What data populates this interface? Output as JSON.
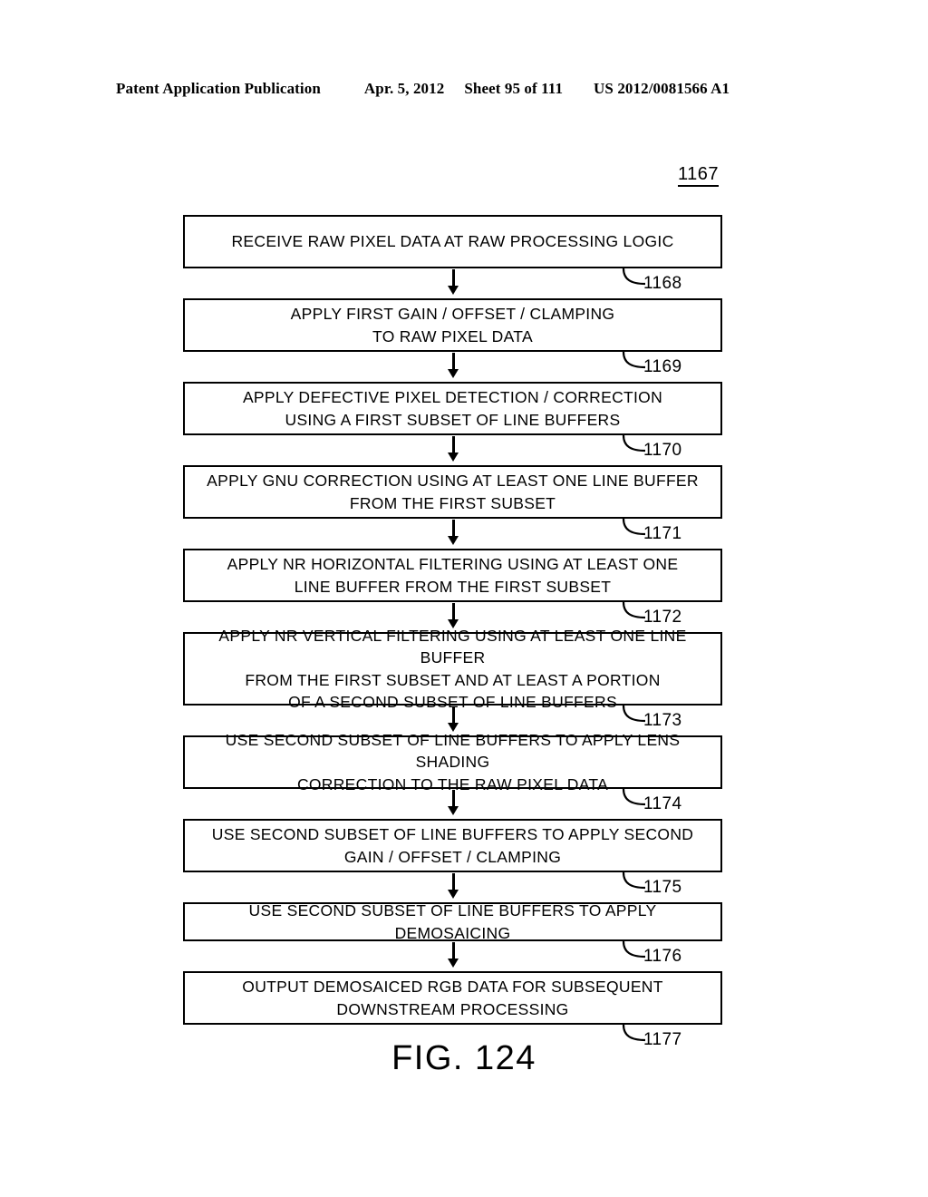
{
  "header": {
    "publication": "Patent Application Publication",
    "date": "Apr. 5, 2012",
    "sheet": "Sheet 95 of 111",
    "patent_number": "US 2012/0081566 A1"
  },
  "figure": {
    "reference_numeral": "1167",
    "caption": "FIG. 124",
    "boxes": [
      {
        "id": "1168",
        "lines": [
          "RECEIVE RAW  PIXEL DATA AT RAW  PROCESSING  LOGIC"
        ],
        "text": "RECEIVE RAW  PIXEL DATA AT RAW  PROCESSING  LOGIC"
      },
      {
        "id": "1169",
        "lines": [
          "APPLY  FIRST  GAIN  / OFFSET / CLAMPING",
          "TO  RAW   PIXEL  DATA"
        ],
        "text": "APPLY FIRST GAIN /OFFSET /CLAMPING TO RAW PIXEL DATA"
      },
      {
        "id": "1170",
        "lines": [
          "APPLY  DEFECTIVE  PIXEL  DETECTION  / CORRECTION",
          "USING  A  FIRST  SUBSET  OF  LINE  BUFFERS"
        ],
        "text": "APPLY DEFECTIVE PIXEL DETECTION /CORRECTION USING A FIRST SUBSET OF LINE BUFFERS"
      },
      {
        "id": "1171",
        "lines": [
          "APPLY  GNU  CORRECTION  USING  AT  LEAST  ONE  LINE  BUFFER",
          "FROM  THE  FIRST  SUBSET"
        ],
        "text": "APPLY GNU CORRECTION USING AT LEAST ONE LINE BUFFER FROM THE FIRST SUBSET"
      },
      {
        "id": "1172",
        "lines": [
          "APPLY  NR  HORIZONTAL  FILTERING  USING  AT  LEAST  ONE",
          "LINE  BUFFER  FROM  THE  FIRST  SUBSET"
        ],
        "text": "APPLY NR HORIZONTAL FILTERING USING AT LEAST ONE LINE BUFFER FROM THE FIRST SUBSET"
      },
      {
        "id": "1173",
        "lines": [
          "APPLY  NR  VERTICAL  FILTERING  USING  AT  LEAST  ONE  LINE  BUFFER",
          "FROM  THE  FIRST  SUBSET  AND  AT  LEAST  A  PORTION",
          "OF  A  SECOND  SUBSET  OF  LINE  BUFFERS"
        ],
        "text": "APPLY NR VERTICAL FILTERING USING AT LEAST ONE LINE BUFFER FROM THE FIRST SUBSET AND AT LEAST A PORTION OF A SECOND SUBSET OF LINE BUFFERS"
      },
      {
        "id": "1174",
        "lines": [
          "USE  SECOND  SUBSET  OF  LINE  BUFFERS  TO  APPLY LENS SHADING",
          "CORRECTION  TO  THE  RAW   PIXEL  DATA"
        ],
        "text": "USE SECOND SUBSET OF LINE BUFFERS TO APPLY LENS SHADING CORRECTION TO THE RAW PIXEL DATA"
      },
      {
        "id": "1175",
        "lines": [
          "USE  SECOND  SUBSET  OF  LINE  BUFFERS  TO  APPLY  SECOND",
          "GAIN  / OFFSET / CLAMPING"
        ],
        "text": "USE SECOND SUBSET OF LINE BUFFERS TO APPLY SECOND GAIN /OFFSET /CLAMPING"
      },
      {
        "id": "1176",
        "lines": [
          "USE  SECOND  SUBSET  OF  LINE  BUFFERS  TO  APPLY  DEMOSAICING"
        ],
        "text": "USE SECOND SUBSET OF LINE BUFFERS TO APPLY DEMOSAICING"
      },
      {
        "id": "1177",
        "lines": [
          "OUTPUT  DEMOSAICED  RGB  DATA  FOR  SUBSEQUENT",
          "DOWNSTREAM   PROCESSING"
        ],
        "text": "OUTPUT DEMOSAICED RGB DATA FOR SUBSEQUENT DOWNSTREAM PROCESSING"
      }
    ]
  },
  "colors": {
    "ink": "#000000",
    "paper": "#ffffff"
  }
}
